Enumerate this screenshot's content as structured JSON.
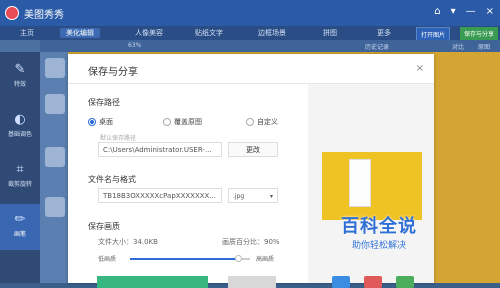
{
  "app": {
    "title": "美图秀秀",
    "window_controls": [
      "⌂",
      "▾",
      "—",
      "×"
    ]
  },
  "nav": {
    "items": [
      "主页",
      "美化编辑",
      "人像美容",
      "贴纸文字",
      "边框场景",
      "拼图",
      "更多"
    ],
    "open_image": "打开图片",
    "save_share": "保存与分享"
  },
  "toolbar": {
    "zoom": "63%",
    "history": "历史记录",
    "compare": "对比",
    "original": "原图"
  },
  "sidebar": {
    "items": [
      "特效",
      "基础调色",
      "裁剪旋转",
      "画笔"
    ],
    "active": "画笔"
  },
  "dialog": {
    "title": "保存与分享",
    "close_icon": "×",
    "save_path": {
      "label": "保存路径",
      "options": [
        "桌面",
        "覆盖原图",
        "自定义"
      ],
      "selected": "桌面",
      "default_hint": "默认保存路径",
      "path_value": "C:\\Users\\Administrator.USER-...",
      "change_button": "更改"
    },
    "filename": {
      "label": "文件名与格式",
      "value": "TB18B3OXXXXXcPapXXXXXXX...",
      "format": ".jpg"
    },
    "quality": {
      "label": "保存画质",
      "file_size_label": "文件大小：34.0KB",
      "percent_label": "画质百分比：90%",
      "low": "低画质",
      "high": "高画质",
      "value_percent": 90
    }
  },
  "watermark": {
    "title": "百科全说",
    "subtitle": "助你轻松解决"
  },
  "colors": {
    "accent": "#2f6bd6",
    "confirm": "#38b680",
    "titlebar": "#2b5aa7"
  }
}
